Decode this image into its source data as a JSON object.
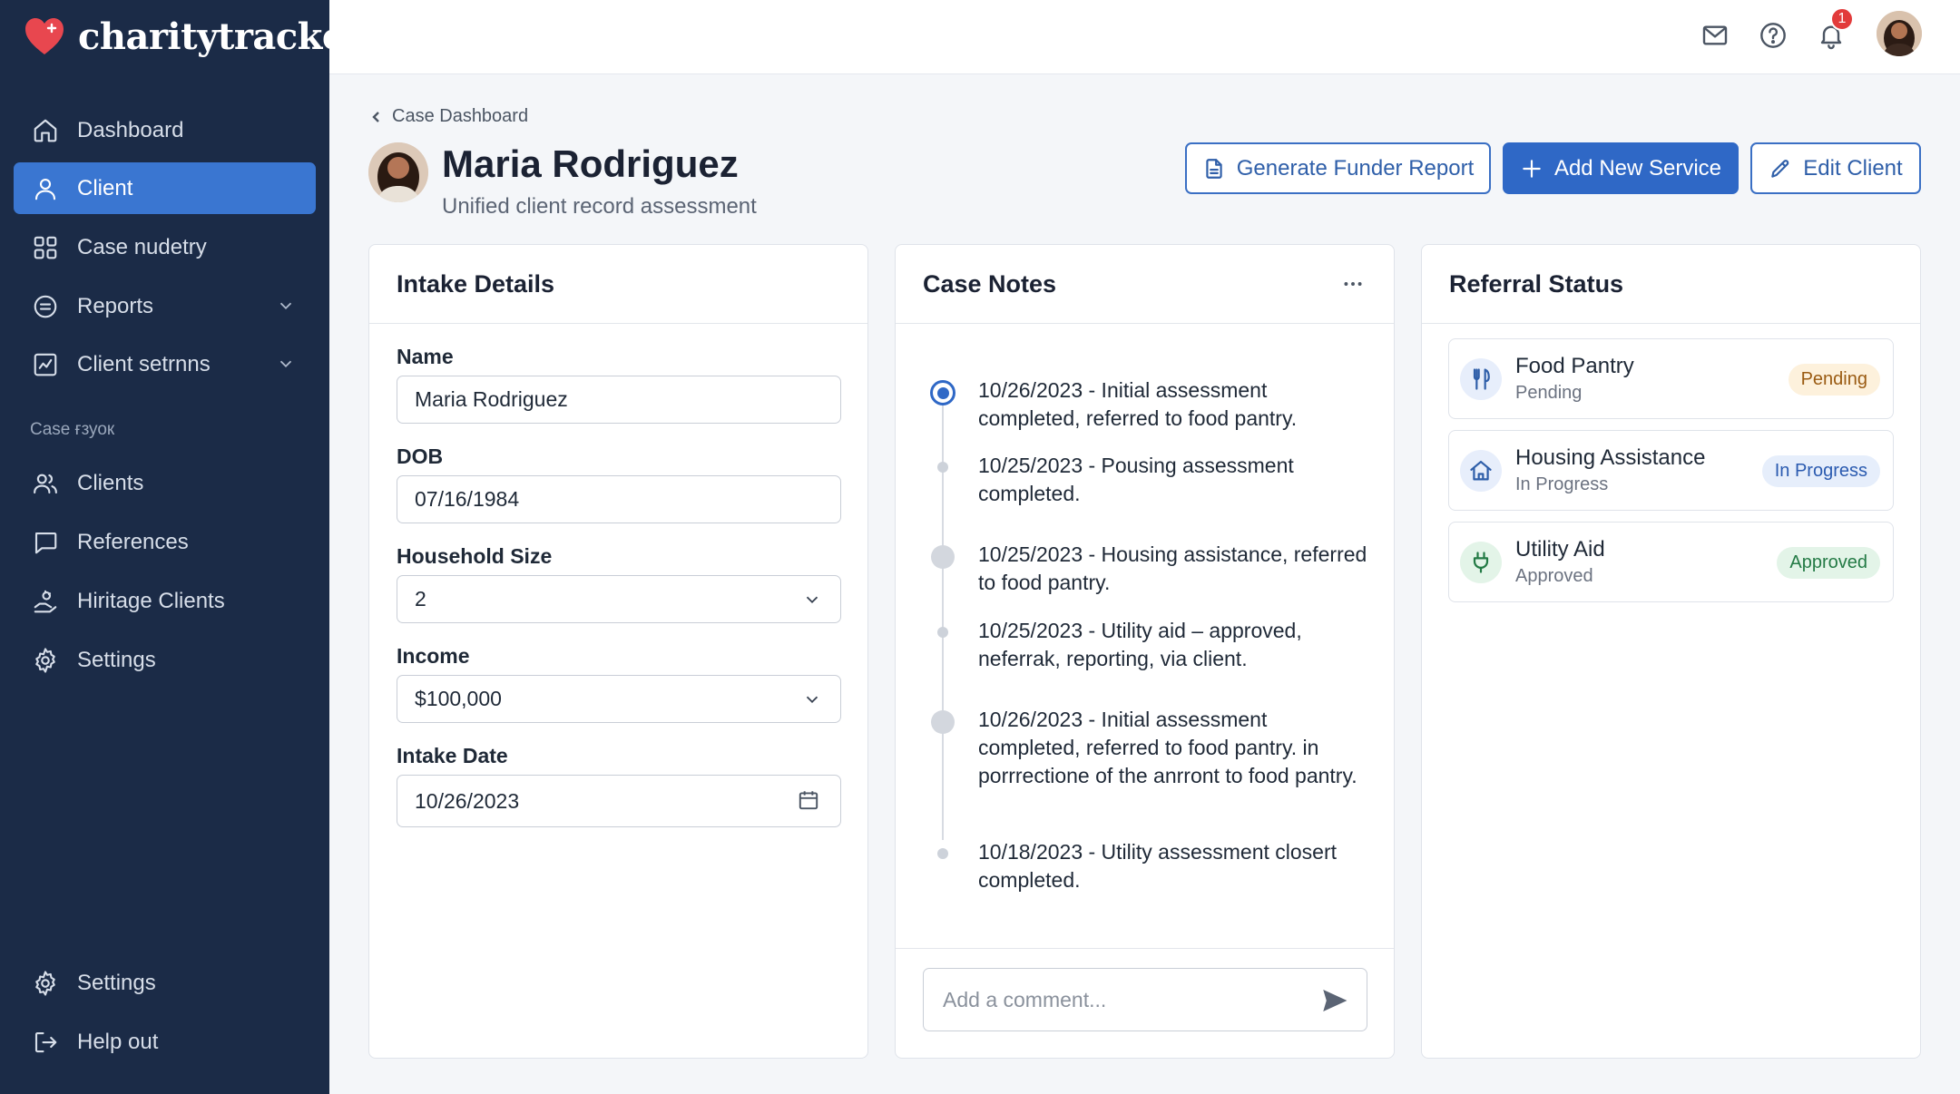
{
  "app": {
    "name": "charitytracker"
  },
  "colors": {
    "sidebar_bg": "#1b2b47",
    "accent": "#2f68c6",
    "notification": "#e23b3b"
  },
  "sidebar": {
    "items": [
      {
        "label": "Dashboard",
        "icon": "home-icon"
      },
      {
        "label": "Client",
        "icon": "user-icon",
        "active": true
      },
      {
        "label": "Case nudetry",
        "icon": "grid-icon"
      },
      {
        "label": "Reports",
        "icon": "report-icon"
      },
      {
        "label": "Client setrnns",
        "icon": "chart-icon"
      }
    ],
    "section_title": "Case ғзуок",
    "section_items": [
      {
        "label": "Clients",
        "icon": "users-icon"
      },
      {
        "label": "References",
        "icon": "message-icon"
      },
      {
        "label": "Hiritage Clients",
        "icon": "hand-icon"
      },
      {
        "label": "Settings",
        "icon": "gear-icon"
      }
    ],
    "bottom_items": [
      {
        "label": "Settings",
        "icon": "gear-icon"
      },
      {
        "label": "Help out",
        "icon": "logout-icon"
      }
    ]
  },
  "topbar": {
    "notification_count": "1",
    "icons": [
      "mail-icon",
      "help-icon",
      "bell-icon"
    ]
  },
  "header": {
    "breadcrumb": "Case Dashboard",
    "client_name": "Maria Rodriguez",
    "subtitle": "Unified client record assessment",
    "buttons": {
      "funder_report": "Generate Funder Report",
      "add_service": "Add New Service",
      "edit_client": "Edit Client"
    }
  },
  "intake": {
    "title": "Intake Details",
    "fields": [
      {
        "label": "Name",
        "value": "Maria Rodriguez",
        "type": "text"
      },
      {
        "label": "DOB",
        "value": "07/16/1984",
        "type": "text"
      },
      {
        "label": "Household Size",
        "value": "2",
        "type": "select"
      },
      {
        "label": "Income",
        "value": "$100,000",
        "type": "select"
      },
      {
        "label": "Intake Date",
        "value": "10/26/2023",
        "type": "date"
      }
    ]
  },
  "case_notes": {
    "title": "Case Notes",
    "notes": [
      {
        "text": "10/26/2023 - Initial assessment completed, referred to food pantry."
      },
      {
        "text": "10/25/2023 - Pousing assessment completed."
      },
      {
        "text": "10/25/2023 - Housing assistance, referred to food pantry."
      },
      {
        "text": "10/25/2023 - Utility aid – approved, neferrak, reporting, via client."
      },
      {
        "text": "10/26/2023 - Initial assessment completed, referred to food pantry. in porrrectione of the anrront to food pantry."
      },
      {
        "text": "10/18/2023 - Utility assessment closert completed."
      }
    ],
    "comment_placeholder": "Add a comment..."
  },
  "referrals": {
    "title": "Referral Status",
    "items": [
      {
        "title": "Food Pantry",
        "status": "Pending",
        "badge": "Pending",
        "icon": "utensils-icon",
        "badge_color": "#9a5b12",
        "badge_bg": "#fdf1dc"
      },
      {
        "title": "Housing Assistance",
        "status": "In Progress",
        "badge": "In Progress",
        "icon": "house-icon",
        "badge_color": "#2b5bb0",
        "badge_bg": "#e6eefb"
      },
      {
        "title": "Utility Aid",
        "status": "Approved",
        "badge": "Approved",
        "icon": "plug-icon",
        "badge_color": "#237a45",
        "badge_bg": "#e3f4e8"
      }
    ]
  }
}
